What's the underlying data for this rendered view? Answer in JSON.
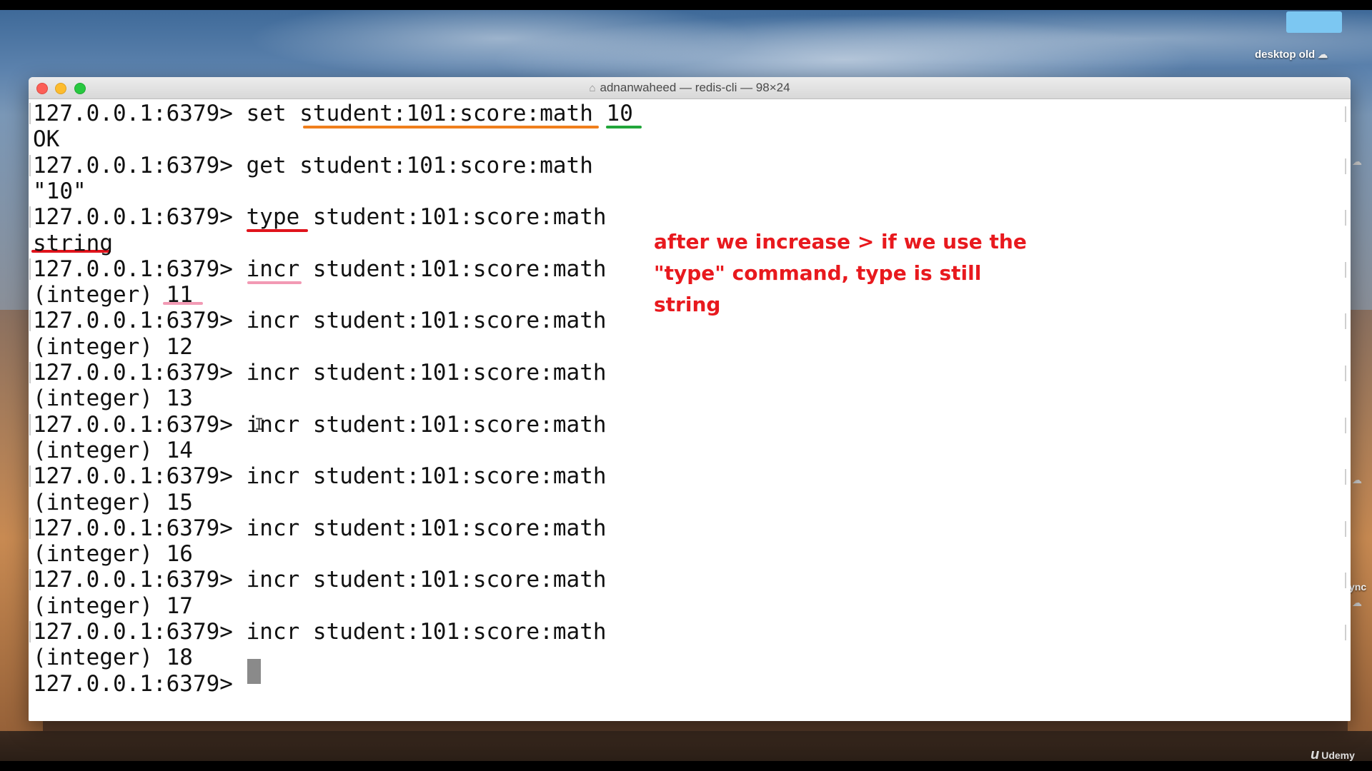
{
  "window": {
    "title": "adnanwaheed — redis-cli — 98×24",
    "title_icon": "home-folder-icon"
  },
  "desktop": {
    "folder_label": "desktop old",
    "side_text": "ync",
    "watermark": "Udemy"
  },
  "terminal": {
    "lines": [
      "127.0.0.1:6379> set student:101:score:math 10",
      "OK",
      "127.0.0.1:6379> get student:101:score:math",
      "\"10\"",
      "127.0.0.1:6379> type student:101:score:math",
      "string",
      "127.0.0.1:6379> incr student:101:score:math",
      "(integer) 11",
      "127.0.0.1:6379> incr student:101:score:math",
      "(integer) 12",
      "127.0.0.1:6379> incr student:101:score:math",
      "(integer) 13",
      "127.0.0.1:6379> incr student:101:score:math",
      "(integer) 14",
      "127.0.0.1:6379> incr student:101:score:math",
      "(integer) 15",
      "127.0.0.1:6379> incr student:101:score:math",
      "(integer) 16",
      "127.0.0.1:6379> incr student:101:score:math",
      "(integer) 17",
      "127.0.0.1:6379> incr student:101:score:math",
      "(integer) 18",
      "127.0.0.1:6379> "
    ]
  },
  "annotation": {
    "lines": [
      "after we increase > if we use the",
      "\"type\" command, type is still",
      "string"
    ],
    "color": "#e8191e"
  },
  "underline_colors": {
    "key": "#f07f1c",
    "value": "#22a63a",
    "type": "#e0141c",
    "incr": "#f29ab4"
  }
}
